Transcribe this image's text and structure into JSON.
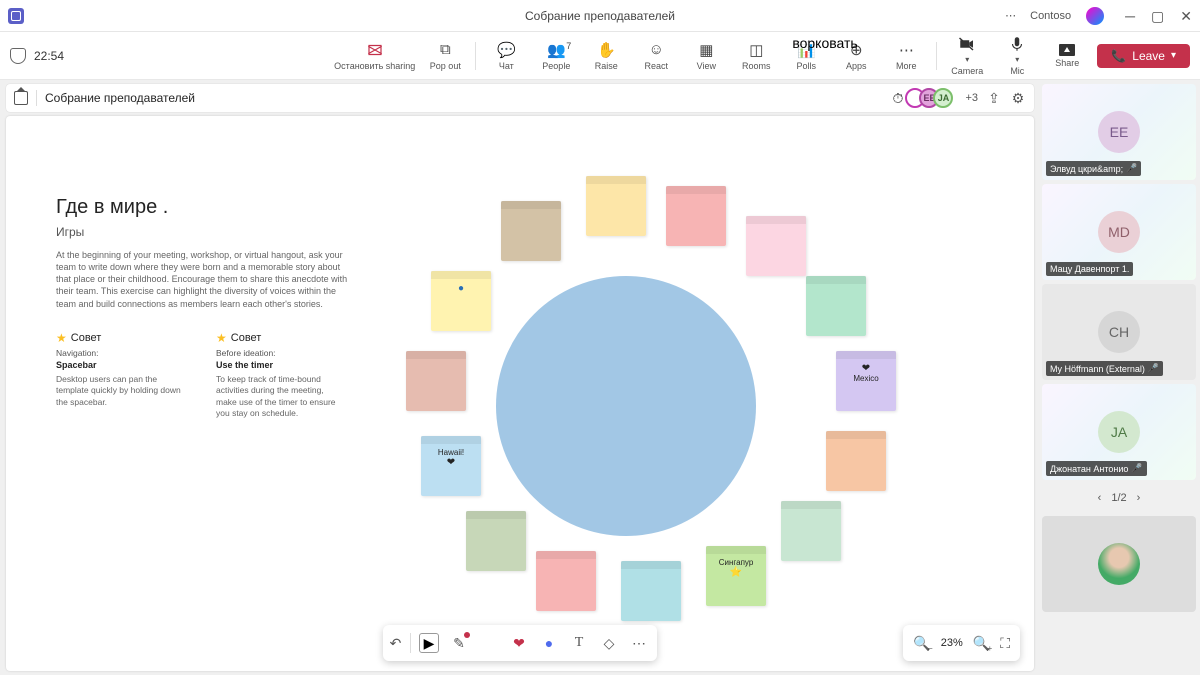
{
  "window": {
    "title": "Собрание преподавателей",
    "org": "Contoso"
  },
  "toolbar": {
    "time": "22:54",
    "buttons": {
      "stopsharing": "Остановить sharing",
      "popout": "Pop out",
      "chat": "Чат",
      "people": "People",
      "people_count": "7",
      "raise": "Raise",
      "react": "React",
      "view": "View",
      "rooms": "Rooms",
      "polls": "Polls",
      "polls_overlay": "ворковать",
      "apps": "Apps",
      "more": "More",
      "camera": "Camera",
      "mic": "Mic",
      "share": "Share",
      "leave": "Leave"
    }
  },
  "stagebar": {
    "title": "Собрание преподавателей",
    "extra_count": "+3"
  },
  "whiteboard": {
    "heading": "Где в мире                  .",
    "sub": "Игры",
    "desc": "At the beginning of your meeting, workshop, or virtual hangout, ask your team to write down where they were born and a memorable story about that place or their childhood. Encourage them to share this anecdote with their team. This exercise can highlight the diversity of voices within the team and build connections as members learn each other's stories.",
    "tips": [
      {
        "title": "Совет",
        "hint": "Navigation:",
        "bold": "Spacebar",
        "body": "Desktop users can pan the template quickly by holding down the spacebar."
      },
      {
        "title": "Совет",
        "hint": "Before ideation:",
        "bold": "Use the timer",
        "body": "To keep track of time-bound activities during the meeting, make use of the timer to ensure you stay on schedule."
      }
    ],
    "notes": {
      "hawaii": "Hawaii!",
      "mexico": "Mexico",
      "singapore": "Сингапур"
    },
    "zoom": "23%"
  },
  "participants": [
    {
      "initials": "EE",
      "name": "Элвуд цкри&amp;",
      "avbg": "#e2cde6",
      "avfg": "#7a5a8c",
      "muted": true
    },
    {
      "initials": "MD",
      "name": "Мацу Давенпорт 1.",
      "avbg": "#ead0d6",
      "avfg": "#8f5f6a",
      "muted": false
    },
    {
      "initials": "CH",
      "name": "My Höffmann (External)",
      "avbg": "#d6d6d6",
      "avfg": "#666",
      "muted": true
    },
    {
      "initials": "JA",
      "name": "Джонатан Антонио",
      "avbg": "#d3e8cf",
      "avfg": "#4f7a46",
      "muted": true
    }
  ],
  "pager": "1/2"
}
